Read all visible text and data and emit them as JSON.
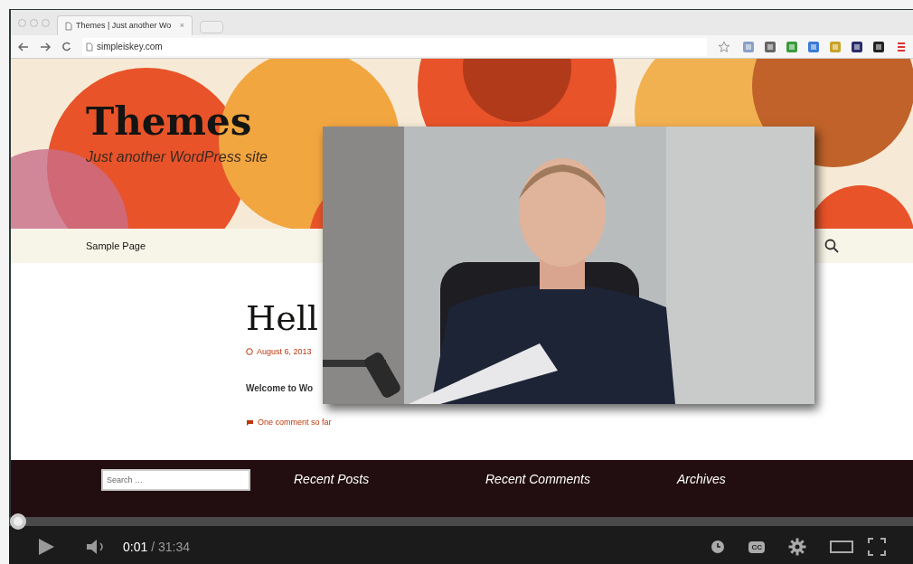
{
  "browser": {
    "tab": {
      "title": "Themes | Just another Wo",
      "close": "×"
    },
    "address": "simpleiskey.com"
  },
  "site": {
    "title": "Themes",
    "tagline": "Just another WordPress site",
    "nav": [
      {
        "label": "Sample Page"
      }
    ]
  },
  "post": {
    "title": "Hell",
    "date": "August 6, 2013",
    "excerpt": "Welcome to Wo",
    "comments": "One comment so far"
  },
  "footer": {
    "search_placeholder": "Search …",
    "widgets": [
      "Recent Posts",
      "Recent Comments",
      "Archives"
    ]
  },
  "player": {
    "progress": {
      "level": 0.001
    },
    "current": "0:01",
    "duration": "/ 31:34",
    "captions": "CC"
  }
}
